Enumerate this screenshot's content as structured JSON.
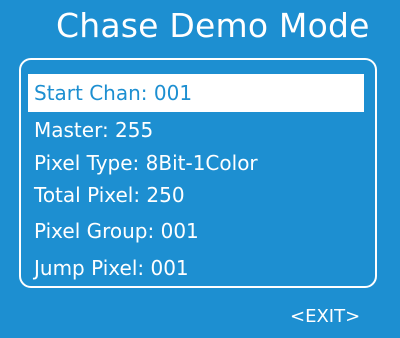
{
  "title": "Chase Demo Mode",
  "menu": {
    "items": [
      {
        "label": "Start Chan: 001",
        "selected": true
      },
      {
        "label": "Master: 255",
        "selected": false
      },
      {
        "label": "Pixel Type: 8Bit-1Color",
        "selected": false
      },
      {
        "label": "Total Pixel: 250",
        "selected": false
      },
      {
        "label": "Pixel Group: 001",
        "selected": false
      },
      {
        "label": "Jump Pixel: 001",
        "selected": false
      }
    ]
  },
  "exit_label": "<EXIT>",
  "colors": {
    "background": "#1d8fd1",
    "foreground": "#ffffff",
    "selection_background": "#ffffff",
    "selection_text": "#1d8fd1"
  }
}
